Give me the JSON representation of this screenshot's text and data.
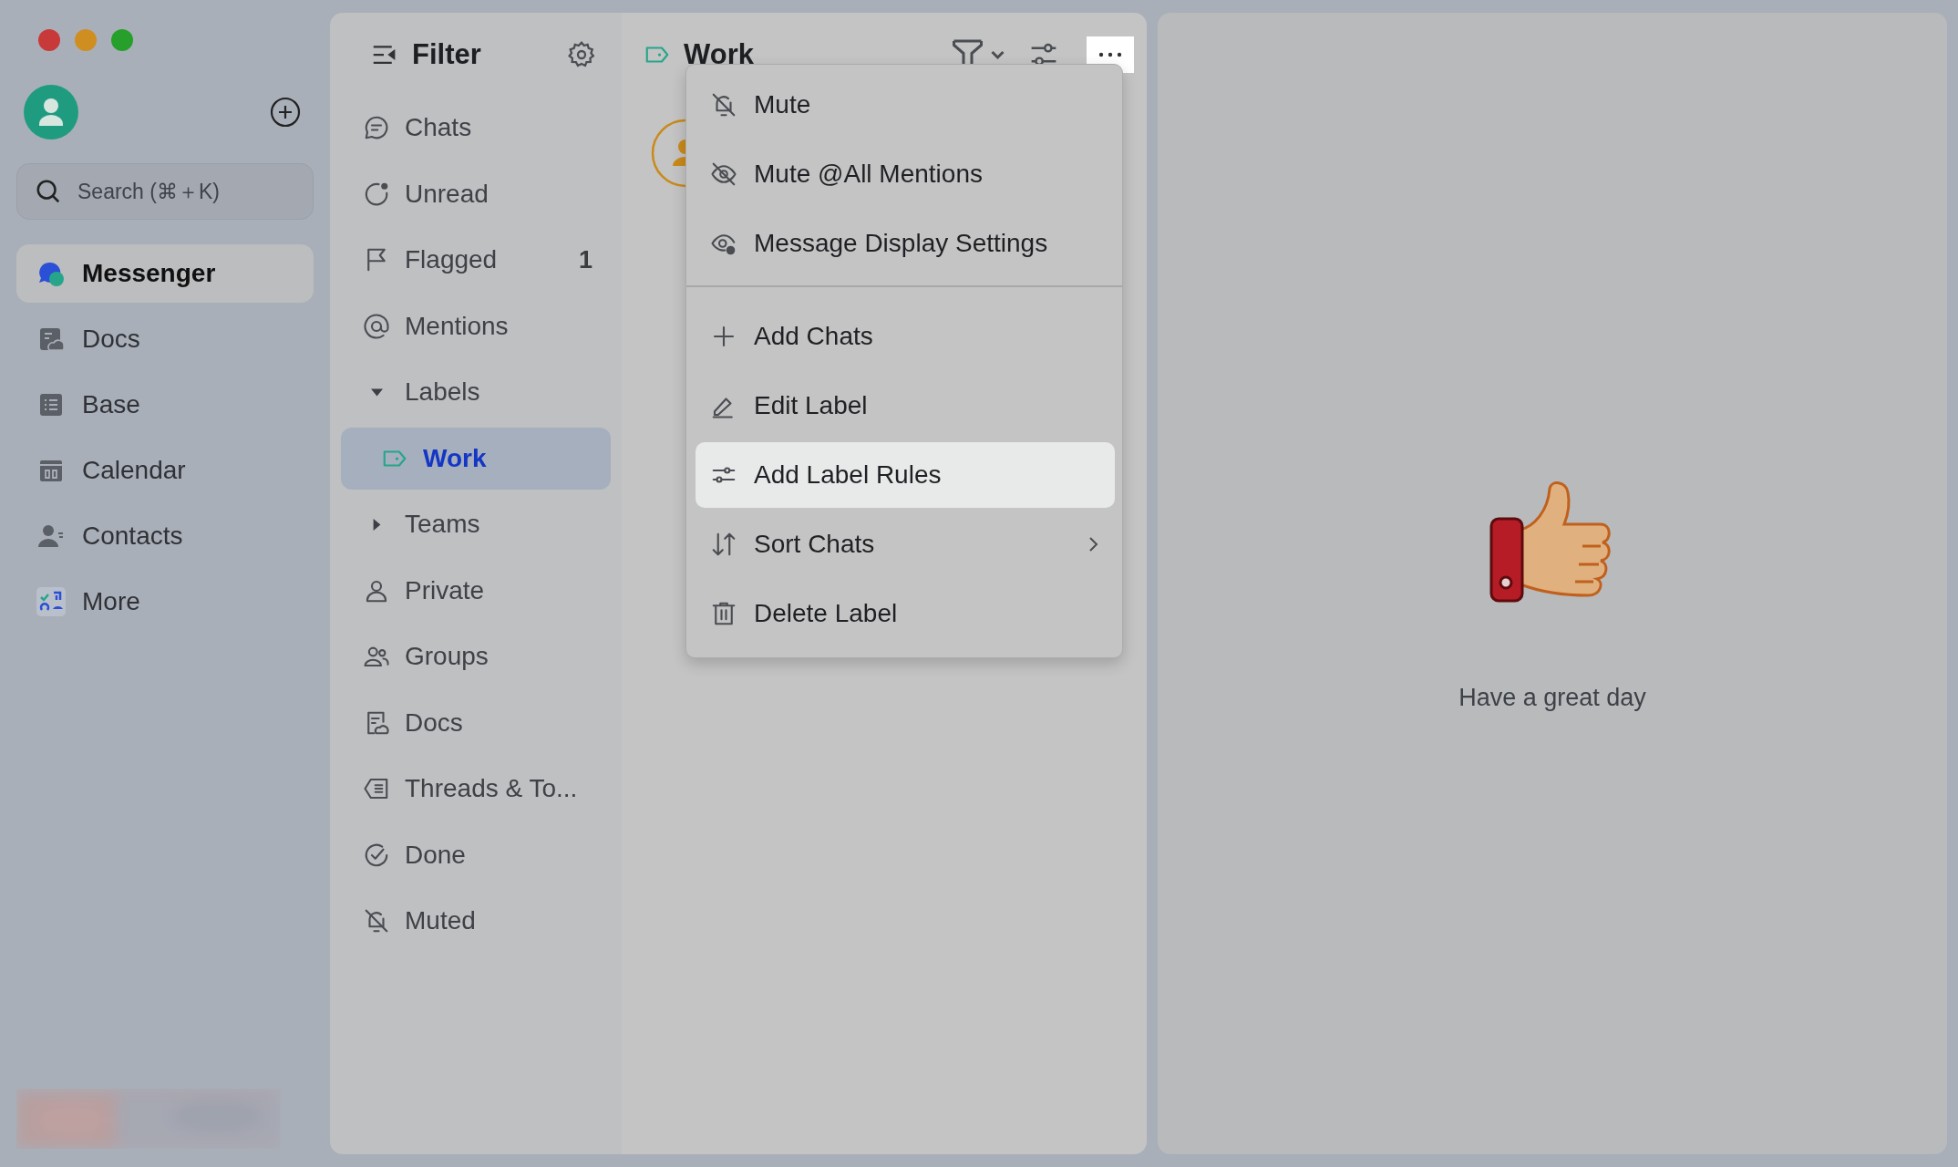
{
  "sidebar": {
    "search": {
      "placeholder": "Search (⌘＋K)"
    },
    "items": [
      {
        "label": "Messenger",
        "selected": true
      },
      {
        "label": "Docs",
        "selected": false
      },
      {
        "label": "Base",
        "selected": false
      },
      {
        "label": "Calendar",
        "selected": false
      },
      {
        "label": "Contacts",
        "selected": false
      },
      {
        "label": "More",
        "selected": false
      }
    ]
  },
  "filter": {
    "title": "Filter",
    "items": [
      {
        "label": "Chats",
        "kind": "item",
        "selected": false
      },
      {
        "label": "Unread",
        "kind": "item",
        "selected": false
      },
      {
        "label": "Flagged",
        "kind": "item",
        "selected": false,
        "count": "1"
      },
      {
        "label": "Mentions",
        "kind": "item",
        "selected": false
      },
      {
        "label": "Labels",
        "kind": "group",
        "expanded": true,
        "children": [
          {
            "label": "Work",
            "selected": true
          }
        ]
      },
      {
        "label": "Teams",
        "kind": "group",
        "expanded": false
      },
      {
        "label": "Private",
        "kind": "item",
        "selected": false
      },
      {
        "label": "Groups",
        "kind": "item",
        "selected": false
      },
      {
        "label": "Docs",
        "kind": "item",
        "selected": false
      },
      {
        "label": "Threads & To...",
        "kind": "item",
        "selected": false
      },
      {
        "label": "Done",
        "kind": "item",
        "selected": false
      },
      {
        "label": "Muted",
        "kind": "item",
        "selected": false
      }
    ]
  },
  "chat_list": {
    "title": "Work"
  },
  "menu": {
    "groups": [
      [
        {
          "label": "Mute",
          "selected": false
        },
        {
          "label": "Mute @All Mentions",
          "selected": false
        },
        {
          "label": "Message Display Settings",
          "selected": false
        }
      ],
      [
        {
          "label": "Add Chats",
          "selected": false
        },
        {
          "label": "Edit Label",
          "selected": false
        },
        {
          "label": "Add Label Rules",
          "selected": true
        },
        {
          "label": "Sort Chats",
          "selected": false,
          "submenu": true
        },
        {
          "label": "Delete Label",
          "selected": false
        }
      ]
    ]
  },
  "empty_state": {
    "message": "Have a great day"
  }
}
